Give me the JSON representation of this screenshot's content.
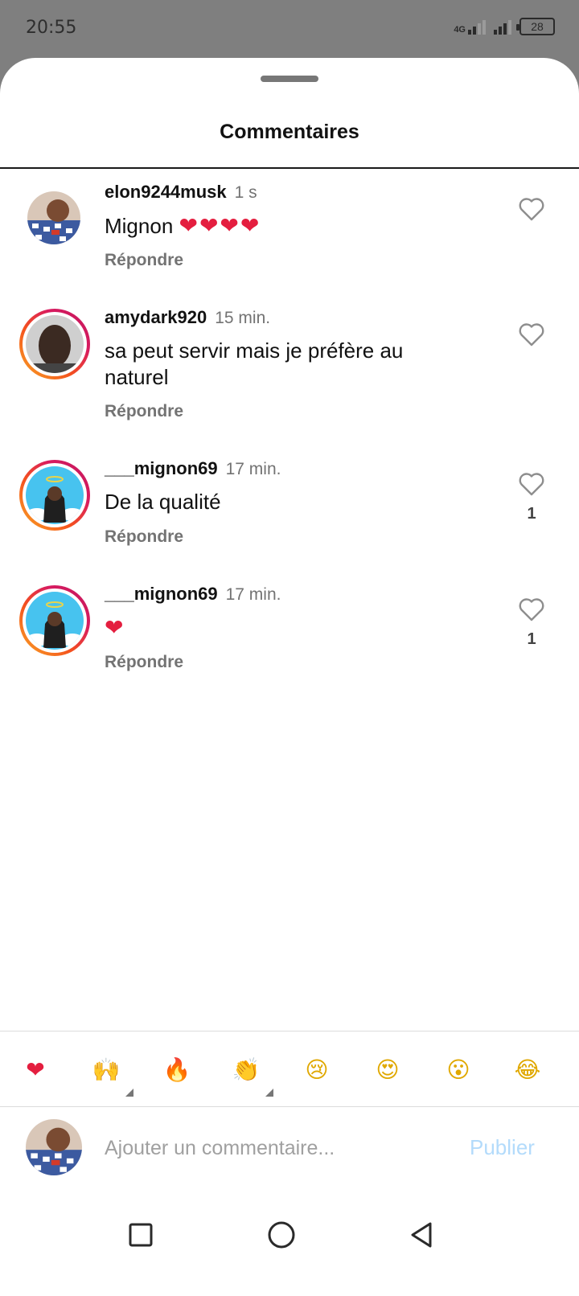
{
  "status_bar": {
    "time": "20:55",
    "network": "4G",
    "battery": "28"
  },
  "sheet": {
    "title": "Commentaires"
  },
  "comments": [
    {
      "username": "elon9244musk",
      "time": "1 s",
      "text": "Mignon ",
      "emoji": "❤❤❤❤",
      "reply_label": "Répondre",
      "likes": "",
      "avatar_story_ring": false
    },
    {
      "username": "amydark920",
      "time": "15 min.",
      "text": "sa peut servir mais je préfère au naturel",
      "emoji": "",
      "reply_label": "Répondre",
      "likes": "",
      "avatar_story_ring": true
    },
    {
      "username": "___mignon69",
      "time": "17 min.",
      "text": "De la qualité",
      "emoji": "",
      "reply_label": "Répondre",
      "likes": "1",
      "avatar_story_ring": true
    },
    {
      "username": "___mignon69",
      "time": "17 min.",
      "text": "",
      "emoji": "❤",
      "reply_label": "Répondre",
      "likes": "1",
      "avatar_story_ring": true
    }
  ],
  "emoji_bar": [
    {
      "name": "red-heart",
      "char": "❤"
    },
    {
      "name": "raising-hands",
      "char": "🙌"
    },
    {
      "name": "fire",
      "char": "🔥"
    },
    {
      "name": "clapping-hands",
      "char": "👏"
    },
    {
      "name": "crying-face",
      "char": "😢"
    },
    {
      "name": "heart-eyes",
      "char": "😍"
    },
    {
      "name": "surprised-face",
      "char": "😮"
    },
    {
      "name": "tears-of-joy",
      "char": "😂"
    }
  ],
  "composer": {
    "placeholder": "Ajouter un commentaire...",
    "publish_label": "Publier"
  },
  "colors": {
    "accent_disabled": "#b3dbfb",
    "heart": "#e41e3f",
    "secondary_text": "#737373"
  }
}
